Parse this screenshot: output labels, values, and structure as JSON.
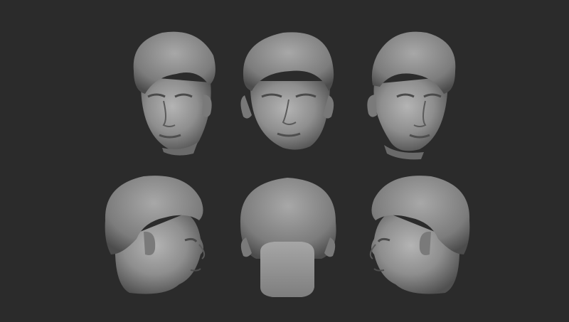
{
  "scene": {
    "background_color": "#2b2b2b",
    "clay_color": "#8f8f8f",
    "views": [
      {
        "name": "three-quarter-left"
      },
      {
        "name": "front"
      },
      {
        "name": "three-quarter-right"
      },
      {
        "name": "profile-right"
      },
      {
        "name": "back"
      },
      {
        "name": "profile-left"
      }
    ]
  }
}
